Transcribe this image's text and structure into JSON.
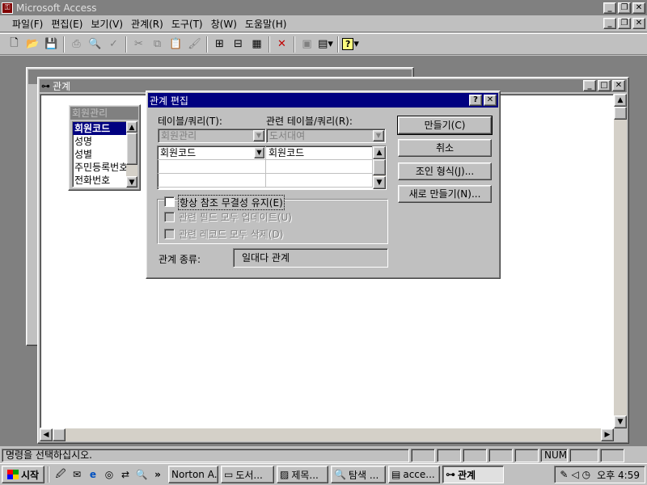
{
  "app": {
    "title": "Microsoft Access"
  },
  "menu": [
    "파일(F)",
    "편집(E)",
    "보기(V)",
    "관계(R)",
    "도구(T)",
    "창(W)",
    "도움말(H)"
  ],
  "windows": {
    "background_title": "",
    "relationships_title": "관계"
  },
  "field_list": {
    "title": "회원관리",
    "items": [
      "회원코드",
      "성명",
      "성별",
      "주민등록번호",
      "전화번호"
    ]
  },
  "dialog": {
    "title": "관계 편집",
    "table_label": "테이블/쿼리(T):",
    "related_label": "관련 테이블/쿼리(R):",
    "table_value": "회원관리",
    "related_value": "도서대여",
    "rows": [
      {
        "left": "회원코드",
        "right": "회원코드"
      },
      {
        "left": "",
        "right": ""
      },
      {
        "left": "",
        "right": ""
      }
    ],
    "buttons": {
      "create": "만들기(C)",
      "cancel": "취소",
      "join": "조인 형식(J)...",
      "new": "새로 만들기(N)..."
    },
    "checks": {
      "enforce": "항상 참조 무결성 유지(E)",
      "cascade_update": "관련 필드 모두 업데이트(U)",
      "cascade_delete": "관련 레코드 모두 삭제(D)"
    },
    "relation_type_label": "관계 종류:",
    "relation_type_value": "일대다 관계"
  },
  "status": {
    "message": "명령을 선택하십시오.",
    "num": "NUM"
  },
  "taskbar": {
    "start": "시작",
    "tasks": [
      "Norton A...",
      "도서...",
      "제목...",
      "탐색 ...",
      "acce...",
      "관계"
    ],
    "clock": "오후 4:59"
  }
}
